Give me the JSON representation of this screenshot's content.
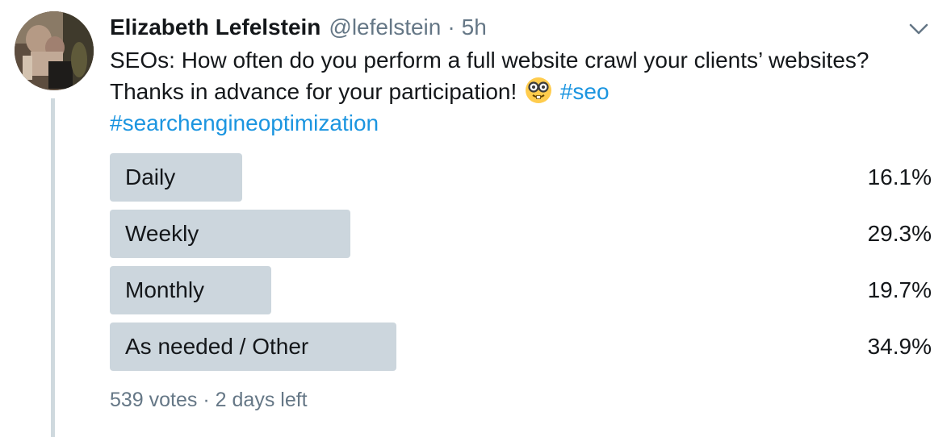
{
  "tweet": {
    "author_name": "Elizabeth Lefelstein",
    "handle": "@lefelstein",
    "separator": "·",
    "timestamp": "5h",
    "text_part1": "SEOs: How often do you perform a full website crawl your clients’ websites? Thanks in advance for your participation!",
    "emoji": "nerd-face-emoji",
    "hashtags": [
      "#seo",
      "#searchengineoptimization"
    ]
  },
  "poll": {
    "options": [
      {
        "label": "Daily",
        "percent": "16.1%",
        "fraction": 0.161
      },
      {
        "label": "Weekly",
        "percent": "29.3%",
        "fraction": 0.293
      },
      {
        "label": "Monthly",
        "percent": "19.7%",
        "fraction": 0.197
      },
      {
        "label": "As needed / Other",
        "percent": "34.9%",
        "fraction": 0.349
      }
    ],
    "votes": "539 votes",
    "separator": "·",
    "time_left": "2 days left"
  },
  "icons": {
    "menu": "chevron-down-icon"
  },
  "colors": {
    "text": "#14171a",
    "secondary": "#657786",
    "link": "#1b95e0",
    "bar": "#ccd6dd"
  }
}
